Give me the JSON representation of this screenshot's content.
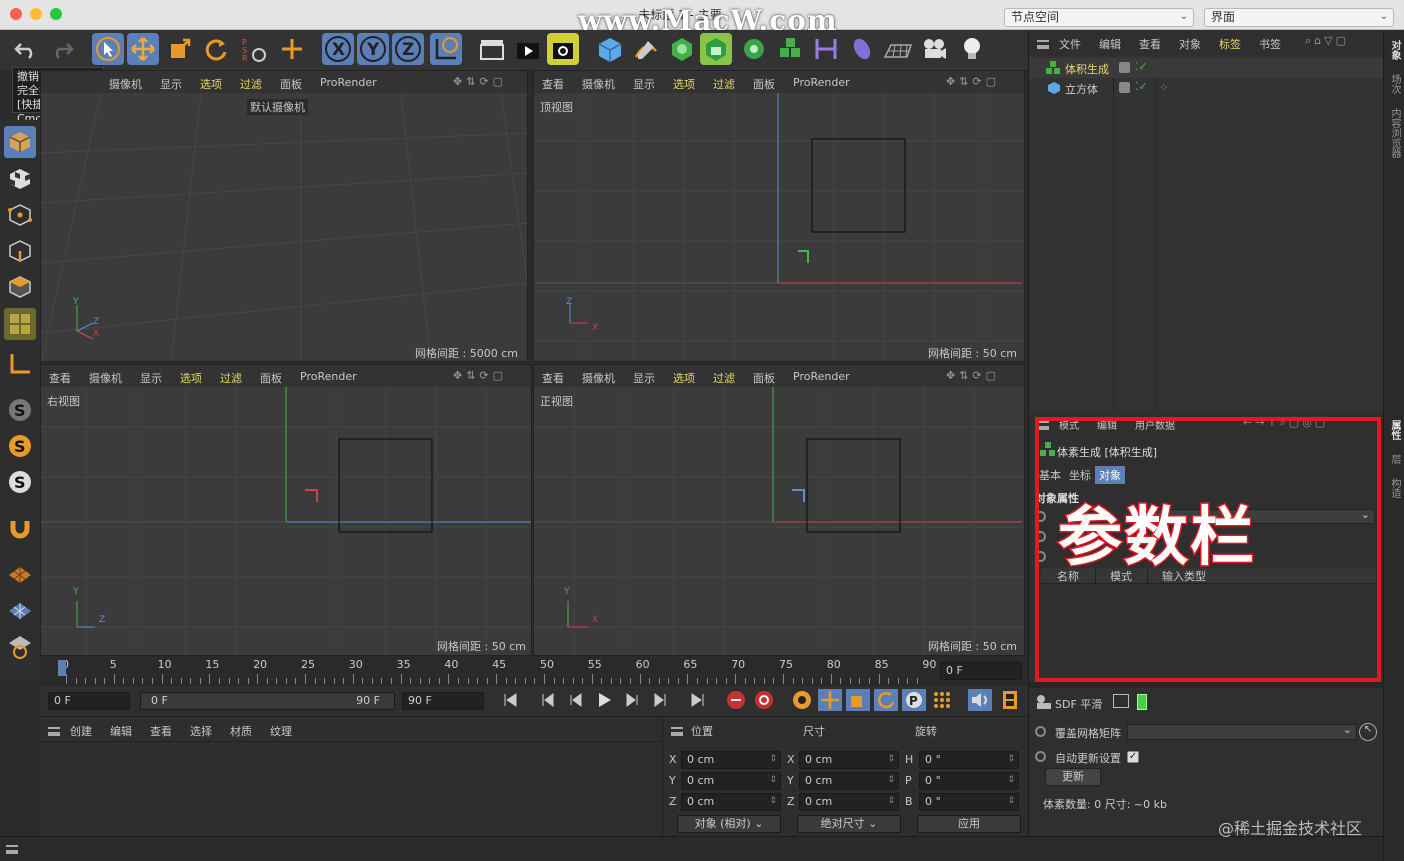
{
  "window": {
    "title": "未标题 1 - 主要",
    "watermark": "www.MacW.com"
  },
  "top_combos": {
    "node_space": "节点空间",
    "layout": "界面"
  },
  "tooltip": {
    "line1": "撤销",
    "line2": "完全撤销",
    "line3": "[快捷键 Cmd+Z]"
  },
  "viewport_menu": [
    "查看",
    "摄像机",
    "显示",
    "选项",
    "过滤",
    "面板",
    "ProRender"
  ],
  "viewports": {
    "perspective": {
      "camera": "默认摄像机",
      "grid": "网格间距 : 5000 cm"
    },
    "top": {
      "name": "顶视图",
      "grid": "网格间距 : 50 cm"
    },
    "right": {
      "name": "右视图",
      "grid": "网格间距 : 50 cm"
    },
    "front": {
      "name": "正视图",
      "grid": "网格间距 : 50 cm"
    }
  },
  "axis_labels": {
    "x": "X",
    "y": "Y",
    "z": "Z"
  },
  "object_manager": {
    "menu": [
      "文件",
      "编辑",
      "查看",
      "对象",
      "标签",
      "书签"
    ],
    "objects": [
      {
        "name": "体积生成",
        "highlight": true
      },
      {
        "name": "立方体",
        "highlight": false
      }
    ]
  },
  "right_tabs": [
    "对象",
    "场次",
    "内容浏览器",
    "属性",
    "层",
    "构造"
  ],
  "attributes": {
    "menu": [
      "模式",
      "编辑",
      "用户数据"
    ],
    "object_title": "体素生成 [体积生成]",
    "tabs": [
      "基本",
      "坐标",
      "对象"
    ],
    "active_tab": "对象",
    "section": "对象属性",
    "columns": [
      "名称",
      "模式",
      "输入类型"
    ],
    "sdf": "SDF 平滑",
    "override_matrix": "覆盖网格矩阵",
    "auto_update": "自动更新设置",
    "update_button": "更新",
    "voxel_info": "体素数量: 0   尺寸: ~0 kb"
  },
  "annotation": "参数栏",
  "timeline": {
    "ticks": [
      "0",
      "5",
      "10",
      "15",
      "20",
      "25",
      "30",
      "35",
      "40",
      "45",
      "50",
      "55",
      "60",
      "65",
      "70",
      "75",
      "80",
      "85",
      "90"
    ],
    "current_frame": "0 F",
    "start": "0 F",
    "range_start": "0 F",
    "range_end": "90 F",
    "end": "90 F"
  },
  "material_menu": [
    "创建",
    "编辑",
    "查看",
    "选择",
    "材质",
    "纹理"
  ],
  "coords": {
    "headers": [
      "位置",
      "尺寸",
      "旋转"
    ],
    "rows": [
      {
        "axis": "X",
        "pos": "0 cm",
        "size_axis": "X",
        "size": "0 cm",
        "rot_axis": "H",
        "rot": "0 °"
      },
      {
        "axis": "Y",
        "pos": "0 cm",
        "size_axis": "Y",
        "size": "0 cm",
        "rot_axis": "P",
        "rot": "0 °"
      },
      {
        "axis": "Z",
        "pos": "0 cm",
        "size_axis": "Z",
        "size": "0 cm",
        "rot_axis": "B",
        "rot": "0 °"
      }
    ],
    "mode1": "对象 (相对)",
    "mode2": "绝对尺寸",
    "apply": "应用"
  },
  "footer_watermark": "@稀土掘金技术社区",
  "colors": {
    "accent_blue": "#5b80b8",
    "highlight_yellow": "#e6d96a",
    "red_box": "#e01a22",
    "axis_x": "#d04040",
    "axis_y": "#40b040",
    "axis_z": "#4080d0"
  }
}
